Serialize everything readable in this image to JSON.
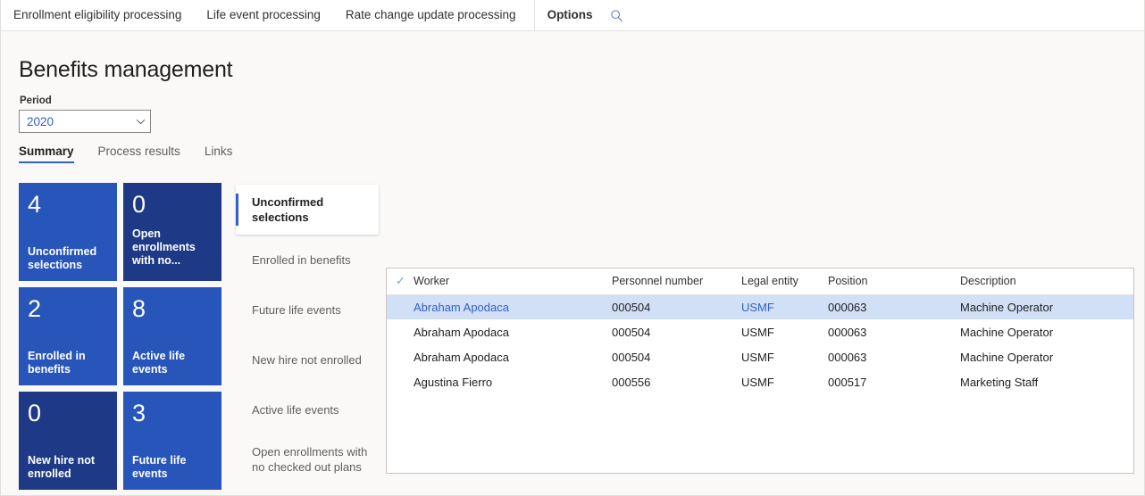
{
  "topnav": {
    "items": [
      {
        "label": "Enrollment eligibility processing",
        "strong": false
      },
      {
        "label": "Life event processing",
        "strong": false
      },
      {
        "label": "Rate change update processing",
        "strong": false
      }
    ],
    "options_label": "Options",
    "search_icon": "search-icon"
  },
  "page": {
    "title": "Benefits management",
    "period_label": "Period",
    "period_value": "2020",
    "period_chevron_icon": "chevron-down-icon"
  },
  "tabs": [
    {
      "label": "Summary",
      "active": true
    },
    {
      "label": "Process results",
      "active": false
    },
    {
      "label": "Links",
      "active": false
    }
  ],
  "tiles": [
    {
      "count": "4",
      "label": "Unconfirmed selections",
      "tone": "bright"
    },
    {
      "count": "0",
      "label": "Open enrollments with no...",
      "tone": "dark"
    },
    {
      "count": "2",
      "label": "Enrolled in benefits",
      "tone": "bright"
    },
    {
      "count": "8",
      "label": "Active life events",
      "tone": "bright"
    },
    {
      "count": "0",
      "label": "New hire not enrolled",
      "tone": "dark"
    },
    {
      "count": "3",
      "label": "Future life events",
      "tone": "bright"
    }
  ],
  "midlist": [
    {
      "label": "Unconfirmed selections",
      "active": true
    },
    {
      "label": "Enrolled in benefits",
      "active": false
    },
    {
      "label": "Future life events",
      "active": false
    },
    {
      "label": "New hire not enrolled",
      "active": false
    },
    {
      "label": "Active life events",
      "active": false
    },
    {
      "label": "Open enrollments with no checked out plans",
      "active": false
    }
  ],
  "grid": {
    "select_all_icon": "checkmark-icon",
    "columns": [
      "Worker",
      "Personnel number",
      "Legal entity",
      "Position",
      "Description"
    ],
    "rows": [
      {
        "worker": "Abraham Apodaca",
        "personnel": "000504",
        "legal": "USMF",
        "position": "000063",
        "description": "Machine Operator",
        "selected": true
      },
      {
        "worker": "Abraham Apodaca",
        "personnel": "000504",
        "legal": "USMF",
        "position": "000063",
        "description": "Machine Operator",
        "selected": false
      },
      {
        "worker": "Abraham Apodaca",
        "personnel": "000504",
        "legal": "USMF",
        "position": "000063",
        "description": "Machine Operator",
        "selected": false
      },
      {
        "worker": "Agustina Fierro",
        "personnel": "000556",
        "legal": "USMF",
        "position": "000517",
        "description": "Marketing Staff",
        "selected": false
      }
    ]
  },
  "colors": {
    "accent": "#2f5fc7",
    "tile_bright": "#2755ba",
    "tile_dark": "#1e3a87",
    "row_selected": "#d2e0f7",
    "page_bg": "#faf9f8"
  }
}
